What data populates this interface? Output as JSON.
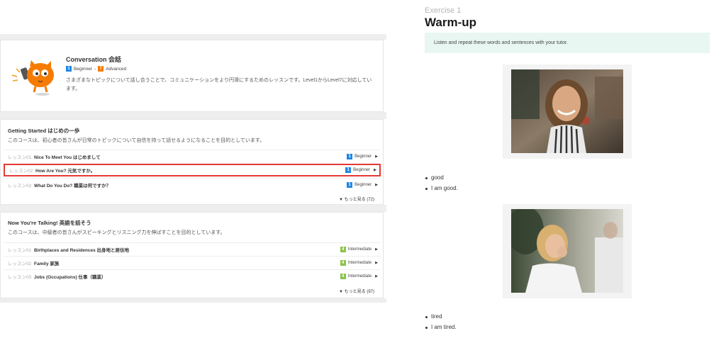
{
  "course": {
    "title": "Conversation 会話",
    "level_from": {
      "num": "1",
      "label": "Beginner"
    },
    "level_sep": "-",
    "level_to": {
      "num": "7",
      "label": "Advanced"
    },
    "description": "さまざまなトピックについて話し合うことで、コミュニケーションをより円滑にするためのレッスンです。Level1からLevel7に対応しています。"
  },
  "sections": [
    {
      "title": "Getting Started はじめの一歩",
      "description": "このコースは、初心者の皆さんが日常のトピックについて自信を持って話せるようになることを目的としています。",
      "lessons": [
        {
          "num": "レッスン01",
          "name": "Nice To Meet You はじめまして",
          "level_num": "1",
          "level": "Beginner",
          "selected": false
        },
        {
          "num": "レッスン02",
          "name": "How Are You? 元気ですか。",
          "level_num": "1",
          "level": "Beginner",
          "selected": true
        },
        {
          "num": "レッスン03",
          "name": "What Do You Do? 職業は何ですか？",
          "level_num": "1",
          "level": "Beginner",
          "selected": false
        }
      ],
      "more": "▼ もっと見る (72)"
    },
    {
      "title": "Now You're Talking! 英語を話そう",
      "description": "このコースは、中級者の皆さんがスピーキングとリスニング力を伸ばすことを目的としています。",
      "lessons": [
        {
          "num": "レッスン01",
          "name": "Birthplaces and Residences 出身地と居住地",
          "level_num": "4",
          "level": "Intermediate",
          "selected": false
        },
        {
          "num": "レッスン02",
          "name": "Family 家族",
          "level_num": "4",
          "level": "Intermediate",
          "selected": false
        },
        {
          "num": "レッスン03",
          "name": "Jobs (Occupations) 仕事（職業）",
          "level_num": "4",
          "level": "Intermediate",
          "selected": false
        }
      ],
      "more": "▼ もっと見る (97)"
    }
  ],
  "exercise": {
    "label": "Exercise 1",
    "title": "Warm-up",
    "instruction": "Listen and repeat these words and sentences with your tutor.",
    "items": [
      {
        "image": "smiling-woman-photo",
        "bullets": [
          "good",
          "I am good."
        ]
      },
      {
        "image": "yawning-woman-photo",
        "bullets": [
          "tired",
          "I am tired."
        ]
      }
    ]
  },
  "colors": {
    "beginner": "#1e88e5",
    "advanced": "#f57c00",
    "intermediate": "#8bc34a",
    "selected_border": "#e53935",
    "instruction_bg": "#e8f7f1"
  }
}
